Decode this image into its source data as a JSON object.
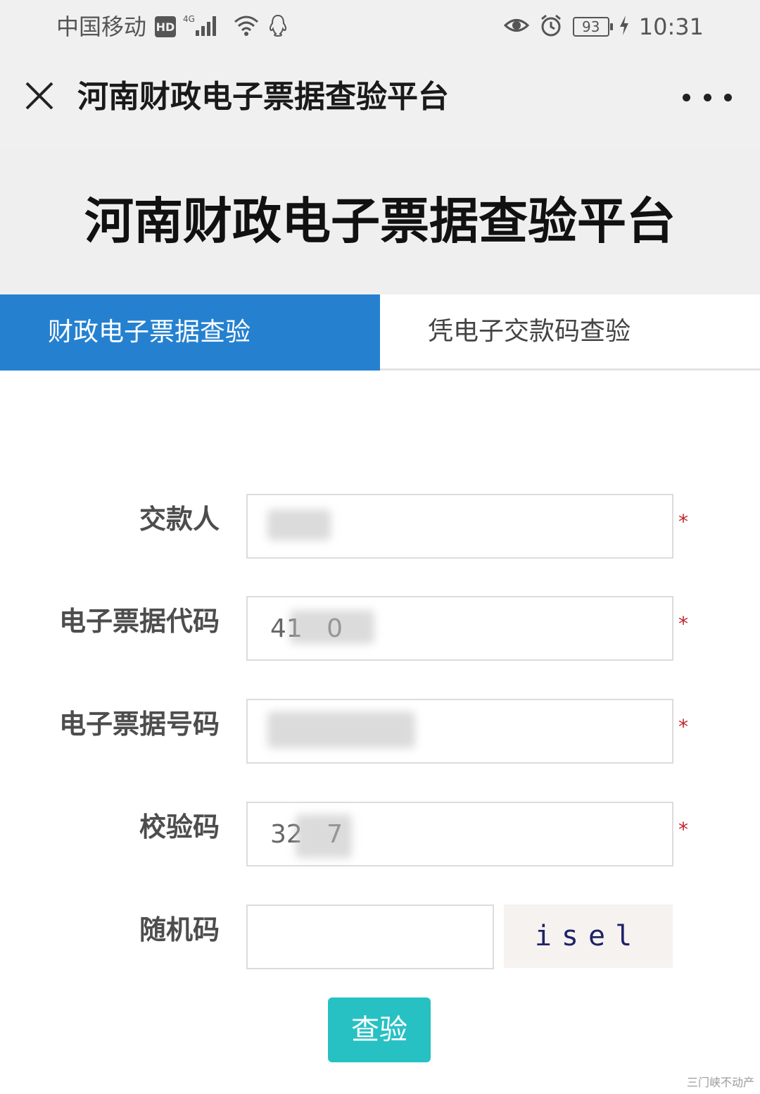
{
  "status_bar": {
    "carrier": "中国移动",
    "hd_badge": "HD",
    "network": "4G",
    "battery": "93",
    "time": "10:31"
  },
  "nav": {
    "title": "河南财政电子票据查验平台"
  },
  "header": {
    "title": "河南财政电子票据查验平台"
  },
  "tabs": [
    {
      "label": "财政电子票据查验",
      "active": true
    },
    {
      "label": "凭电子交款码查验",
      "active": false
    }
  ],
  "form": {
    "payer": {
      "label": "交款人",
      "value": ""
    },
    "bill_code": {
      "label": "电子票据代码",
      "value": "41   0"
    },
    "bill_number": {
      "label": "电子票据号码",
      "value": ""
    },
    "check_code": {
      "label": "校验码",
      "value": "32   7"
    },
    "random_code": {
      "label": "随机码",
      "value": ""
    },
    "required_mark": "*",
    "captcha": "isel"
  },
  "submit_label": "查验",
  "watermark": "三门峡不动产",
  "colors": {
    "tab_active": "#2581d0",
    "submit": "#27c1c3",
    "required": "#c0262d"
  }
}
